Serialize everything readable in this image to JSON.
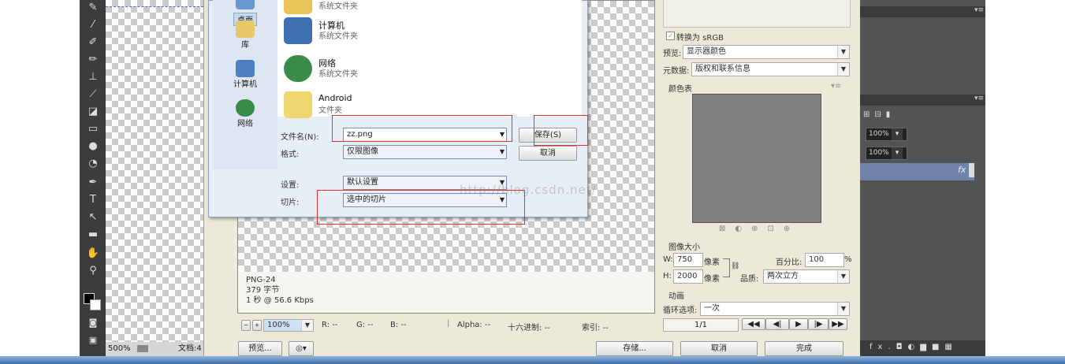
{
  "toolbar_icons": [
    "brush-icon",
    "eyedropper-icon",
    "healing-icon",
    "pencil-icon",
    "stamp-icon",
    "history-brush-icon",
    "eraser-icon",
    "gradient-icon",
    "blur-icon",
    "dodge-icon",
    "pen-icon",
    "type-icon",
    "path-select-icon",
    "rectangle-icon",
    "hand-icon",
    "zoom-icon"
  ],
  "status": {
    "zoom": "500%",
    "doc": "文档:4"
  },
  "file_dialog": {
    "places": [
      {
        "label": "桌面",
        "icon": "desktop-icon"
      },
      {
        "label": "库",
        "icon": "library-icon"
      },
      {
        "label": "计算机",
        "icon": "computer-icon"
      },
      {
        "label": "网络",
        "icon": "network-icon"
      }
    ],
    "items": [
      {
        "name": "",
        "type": "系统文件夹",
        "icon": "folder-icon"
      },
      {
        "name": "计算机",
        "type": "系统文件夹",
        "icon": "computer-icon"
      },
      {
        "name": "网络",
        "type": "系统文件夹",
        "icon": "network-icon"
      },
      {
        "name": "Android",
        "type": "文件夹",
        "icon": "folder-icon"
      }
    ],
    "filename_label": "文件名(N):",
    "filename_value": "zz.png",
    "format_label": "格式:",
    "format_value": "仅限图像",
    "settings_label": "设置:",
    "settings_value": "默认设置",
    "slices_label": "切片:",
    "slices_value": "选中的切片",
    "save_button": "保存(S)",
    "cancel_button": "取消"
  },
  "info": {
    "format": "PNG-24",
    "size": "379 字节",
    "time": "1 秒 @ 56.6 Kbps"
  },
  "bottom_bar": {
    "zoom": "100%",
    "r": "R: --",
    "g": "G: --",
    "b": "B: --",
    "alpha": "Alpha: --",
    "hex": "十六进制: --",
    "index": "索引: --"
  },
  "footer": {
    "preview": "预览...",
    "save": "存储...",
    "cancel": "取消",
    "done": "完成"
  },
  "right": {
    "convert_srgb": "转换为 sRGB",
    "preview_label": "预览:",
    "preview_value": "显示器颜色",
    "metadata_label": "元数据:",
    "metadata_value": "版权和联系信息",
    "color_table": "颜色表",
    "image_size": "图像大小",
    "w_label": "W:",
    "w_value": "750",
    "h_label": "H:",
    "h_value": "2000",
    "px_unit": "像素",
    "percent_label": "百分比:",
    "percent_value": "100",
    "percent_sign": "%",
    "quality_label": "品质:",
    "quality_value": "两次立方",
    "animation": "动画",
    "loop_label": "循环选项:",
    "loop_value": "一次",
    "frame": "1/1"
  },
  "ps_panel": {
    "opacity1": "100%",
    "opacity2": "100%",
    "fx": "fx",
    "bottom_fx": "fx."
  },
  "watermark": "http://blog.csdn.net/"
}
